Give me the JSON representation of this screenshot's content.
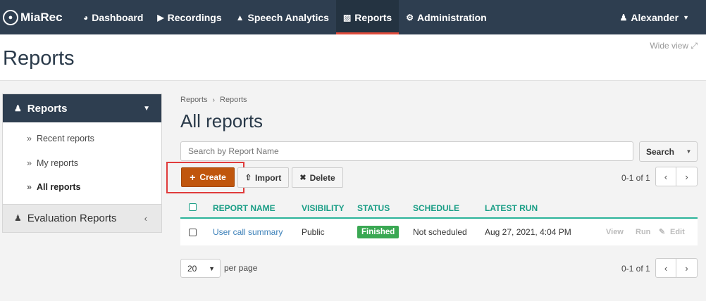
{
  "nav": {
    "brand": "MiaRec",
    "items": [
      {
        "label": "Dashboard",
        "icon": "dashboard-icon"
      },
      {
        "label": "Recordings",
        "icon": "play-icon"
      },
      {
        "label": "Speech Analytics",
        "icon": "area-chart-icon"
      },
      {
        "label": "Reports",
        "icon": "bar-chart-icon"
      },
      {
        "label": "Administration",
        "icon": "gear-icon"
      }
    ],
    "active": "Reports",
    "user": "Alexander"
  },
  "header": {
    "title": "Reports",
    "wide_view": "Wide view"
  },
  "sidebar": {
    "section_label": "Reports",
    "items": [
      {
        "label": "Recent reports"
      },
      {
        "label": "My reports"
      },
      {
        "label": "All reports"
      }
    ],
    "current": "All reports",
    "group_label": "Evaluation Reports"
  },
  "breadcrumb": [
    "Reports",
    "Reports"
  ],
  "main": {
    "title": "All reports"
  },
  "search": {
    "placeholder": "Search by Report Name",
    "button": "Search"
  },
  "toolbar": {
    "create": "Create",
    "import": "Import",
    "delete": "Delete"
  },
  "pager": {
    "top": "0-1 of 1",
    "bottom": "0-1 of 1"
  },
  "table": {
    "headers": [
      "REPORT NAME",
      "VISIBILITY",
      "STATUS",
      "SCHEDULE",
      "LATEST RUN"
    ],
    "rows": [
      {
        "name": "User call summary",
        "visibility": "Public",
        "status": "Finished",
        "schedule": "Not scheduled",
        "latest_run": "Aug 27, 2021, 4:04 PM",
        "actions": {
          "view": "View",
          "run": "Run",
          "edit": "Edit"
        }
      }
    ]
  },
  "footer": {
    "per_page_value": "20",
    "per_page_label": "per page"
  },
  "colors": {
    "navbar": "#2e3e50",
    "accent_teal": "#1a9e86",
    "create_button": "#c0560d",
    "status_finished": "#3aa853",
    "active_underline": "#e04b3c",
    "highlight": "#e03b3b"
  }
}
